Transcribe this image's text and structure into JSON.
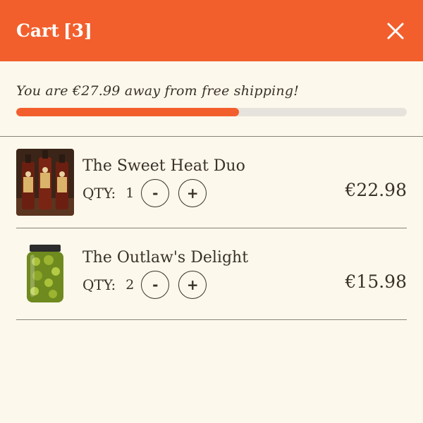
{
  "header": {
    "title": "Cart",
    "count": "[3]",
    "close_icon": "close-icon",
    "background": "#f25f2c"
  },
  "shipping": {
    "message": "You are €27.99 away from free shipping!",
    "progress_fraction": 0.57,
    "progress_color": "#f25f2c"
  },
  "items": [
    {
      "name": "The Sweet Heat Duo",
      "qty_label": "QTY:",
      "qty": "1",
      "minus": "-",
      "plus": "+",
      "price": "€22.98",
      "thumb_icon": "hot-sauce-bottles-image"
    },
    {
      "name": "The Outlaw's Delight",
      "qty_label": "QTY:",
      "qty": "2",
      "minus": "-",
      "plus": "+",
      "price": "€15.98",
      "thumb_icon": "pickled-jalapeno-jar-image"
    }
  ]
}
